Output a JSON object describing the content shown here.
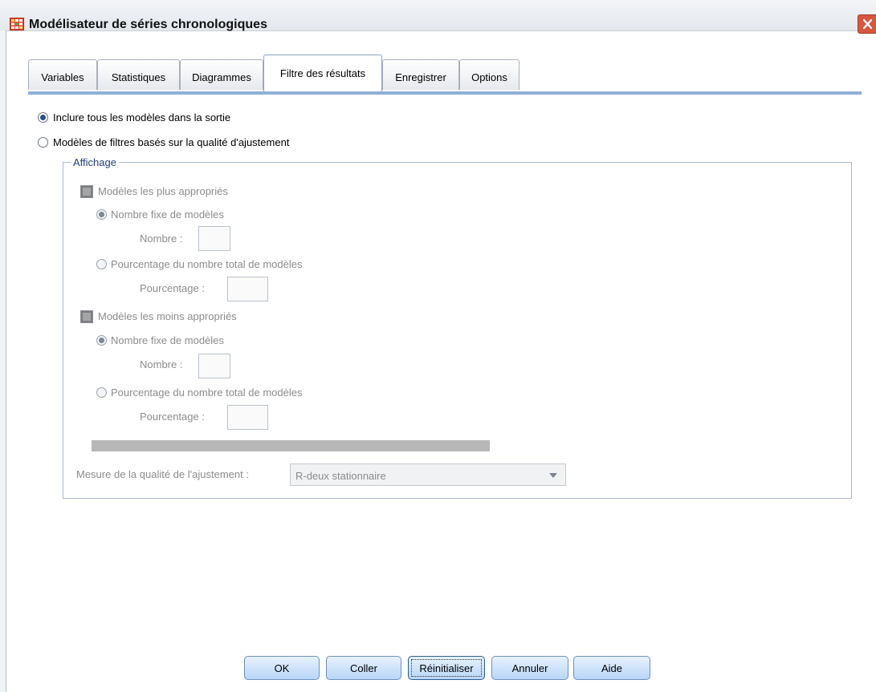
{
  "window": {
    "title": "Modélisateur de séries chronologiques"
  },
  "tabs": [
    {
      "label": "Variables",
      "active": false
    },
    {
      "label": "Statistiques",
      "active": false
    },
    {
      "label": "Diagrammes",
      "active": false
    },
    {
      "label": "Filtre des résultats",
      "active": true
    },
    {
      "label": "Enregistrer",
      "active": false
    },
    {
      "label": "Options",
      "active": false
    }
  ],
  "filter": {
    "include_all_label": "Inclure tous les modèles dans la sortie",
    "include_all_checked": true,
    "fit_filter_label": "Modèles de filtres basés sur la qualité d'ajustement",
    "fit_filter_checked": false
  },
  "display": {
    "legend": "Affichage",
    "best": {
      "label": "Modèles les plus appropriés",
      "fixed_label": "Nombre fixe de modèles",
      "fixed_checked": true,
      "number_label": "Nombre :",
      "number_value": "",
      "percent_label": "Pourcentage du nombre total de modèles",
      "percent_checked": false,
      "percentage_label": "Pourcentage :",
      "percentage_value": ""
    },
    "worst": {
      "label": "Modèles les moins appropriés",
      "fixed_label": "Nombre fixe de modèles",
      "fixed_checked": true,
      "number_label": "Nombre :",
      "number_value": "",
      "percent_label": "Pourcentage du nombre total de modèles",
      "percent_checked": false,
      "percentage_label": "Pourcentage :",
      "percentage_value": ""
    },
    "fit_measure_label": "Mesure de la qualité de l'ajustement :",
    "fit_measure_value": "R-deux stationnaire"
  },
  "buttons": {
    "ok": "OK",
    "paste": "Coller",
    "reset": "Réinitialiser",
    "cancel": "Annuler",
    "help": "Aide"
  },
  "colors": {
    "accent": "#8fb0d8",
    "close": "#d8553e",
    "button": "#b8d6f7"
  }
}
